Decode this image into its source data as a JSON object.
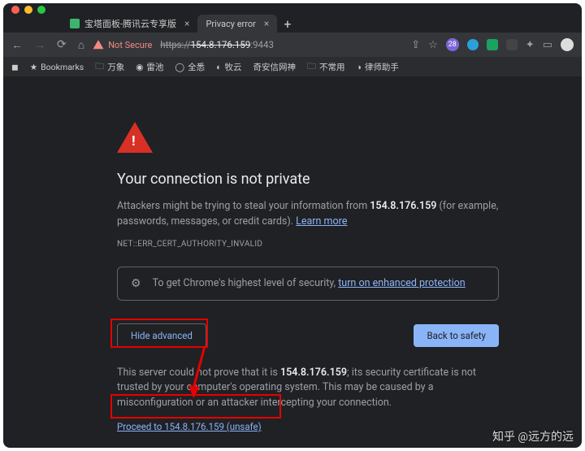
{
  "traffic_colors": {
    "close": "#ff5f57",
    "min": "#febc2e",
    "max": "#28c840"
  },
  "tabs": [
    {
      "title": "宝塔面板-腾讯云专享版",
      "favicon_bg": "#3cb46e"
    },
    {
      "title": "Privacy error",
      "favicon_bg": "#555"
    }
  ],
  "nav": {
    "not_secure_label": "Not Secure",
    "url_prefix": "https://",
    "url_host": "154.8.176.159",
    "url_port": ":9443",
    "badge_count": "28"
  },
  "bookmarks": [
    "Bookmarks",
    "万象",
    "雷池",
    "全悉",
    "牧云",
    "奇安信网神",
    "不常用",
    "律师助手"
  ],
  "page": {
    "heading": "Your connection is not private",
    "para1_a": "Attackers might be trying to steal your information from ",
    "para1_host": "154.8.176.159",
    "para1_b": " (for example, passwords, messages, or credit cards). ",
    "learn_more": "Learn more",
    "err_code": "NET::ERR_CERT_AUTHORITY_INVALID",
    "promo_a": "To get Chrome's highest level of security, ",
    "promo_link": "turn on enhanced protection",
    "btn_hide": "Hide advanced",
    "btn_safety": "Back to safety",
    "adv_a": "This server could not prove that it is ",
    "adv_host": "154.8.176.159",
    "adv_b": "; its security certificate is not trusted by your computer's operating system. This may be caused by a misconfiguration or an attacker intercepting your connection.",
    "proceed": "Proceed to 154.8.176.159 (unsafe)"
  },
  "watermark": "知乎 @远方的远"
}
